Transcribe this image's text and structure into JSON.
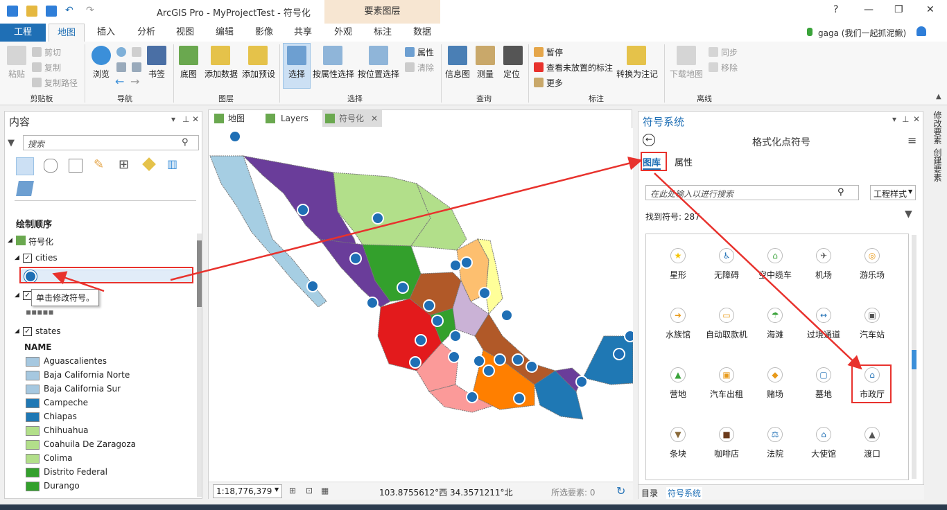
{
  "window": {
    "title": "ArcGIS Pro - MyProjectTest - 符号化",
    "context_tab": "要素图层",
    "help": "?",
    "minimize": "—",
    "restore": "❐",
    "close": "✕"
  },
  "tabs": [
    "工程",
    "地图",
    "插入",
    "分析",
    "视图",
    "编辑",
    "影像",
    "共享",
    "外观",
    "标注",
    "数据"
  ],
  "user": "gaga (我们一起抓泥鳅)",
  "ribbon": {
    "clipboard": {
      "paste": "粘贴",
      "cut": "剪切",
      "copy": "复制",
      "copy_path": "复制路径",
      "group": "剪贴板"
    },
    "nav": {
      "explore": "浏览",
      "bookmark": "书签",
      "group": "导航"
    },
    "layer": {
      "basemap": "底图",
      "add_data": "添加数据",
      "add_preset": "添加预设",
      "group": "图层"
    },
    "select": {
      "select": "选择",
      "by_attr": "按属性选择",
      "by_loc": "按位置选择",
      "attributes": "属性",
      "clear": "清除",
      "group": "选择"
    },
    "inquiry": {
      "info": "信息图",
      "measure": "测量",
      "locate": "定位",
      "group": "查询"
    },
    "label": {
      "pause": "暂停",
      "view_unplaced": "查看未放置的标注",
      "more": "更多",
      "convert": "转换为注记",
      "group": "标注"
    },
    "offline": {
      "download": "下载地图",
      "sync": "同步",
      "remove": "移除",
      "group": "离线"
    }
  },
  "contents": {
    "title": "内容",
    "search_placeholder": "搜索",
    "draw_order": "绘制顺序",
    "map_name": "符号化",
    "layer_cities": "cities",
    "tooltip": "单击修改符号。",
    "layer_states": "states",
    "field_name": "NAME",
    "states": [
      {
        "name": "Aguascalientes",
        "color": "#a6c8e0"
      },
      {
        "name": "Baja California Norte",
        "color": "#a6c8e0"
      },
      {
        "name": "Baja California Sur",
        "color": "#a6c8e0"
      },
      {
        "name": "Campeche",
        "color": "#1f78b4"
      },
      {
        "name": "Chiapas",
        "color": "#1f78b4"
      },
      {
        "name": "Chihuahua",
        "color": "#b2df8a"
      },
      {
        "name": "Coahuila De Zaragoza",
        "color": "#b2df8a"
      },
      {
        "name": "Colima",
        "color": "#b2df8a"
      },
      {
        "name": "Distrito Federal",
        "color": "#33a02c"
      },
      {
        "name": "Durango",
        "color": "#33a02c"
      }
    ]
  },
  "map": {
    "tabs": [
      "地图",
      "Layers",
      "符号化"
    ],
    "scale": "1:18,776,379",
    "coords": "103.8755612°西 34.3571211°北",
    "selected": "所选要素: 0"
  },
  "symbology": {
    "title": "符号系统",
    "header": "格式化点符号",
    "tab_gallery": "图库",
    "tab_props": "属性",
    "search_placeholder": "在此处输入以进行搜索",
    "style_select": "工程样式",
    "found": "找到符号: 287",
    "symbols": [
      {
        "label": "星形",
        "icon": "★",
        "color": "#f5c400"
      },
      {
        "label": "无障碍",
        "icon": "♿",
        "color": "#1f6fb5"
      },
      {
        "label": "空中缆车",
        "icon": "⌂",
        "color": "#3aa33a"
      },
      {
        "label": "机场",
        "icon": "✈",
        "color": "#555555"
      },
      {
        "label": "游乐场",
        "icon": "◎",
        "color": "#e89a1a"
      },
      {
        "label": "水族馆",
        "icon": "➜",
        "color": "#e89a1a"
      },
      {
        "label": "自动取款机",
        "icon": "▭",
        "color": "#e89a1a"
      },
      {
        "label": "海滩",
        "icon": "☂",
        "color": "#3aa33a"
      },
      {
        "label": "过境通道",
        "icon": "↔",
        "color": "#1f6fb5"
      },
      {
        "label": "汽车站",
        "icon": "▣",
        "color": "#555555"
      },
      {
        "label": "营地",
        "icon": "▲",
        "color": "#3aa33a"
      },
      {
        "label": "汽车出租",
        "icon": "▣",
        "color": "#e89a1a"
      },
      {
        "label": "赌场",
        "icon": "◆",
        "color": "#e89a1a"
      },
      {
        "label": "墓地",
        "icon": "▢",
        "color": "#1f6fb5"
      },
      {
        "label": "市政厅",
        "icon": "⌂",
        "color": "#1f6fb5"
      },
      {
        "label": "条块",
        "icon": "▼",
        "color": "#8a6a3a"
      },
      {
        "label": "咖啡店",
        "icon": "■",
        "color": "#6b3a1a"
      },
      {
        "label": "法院",
        "icon": "⚖",
        "color": "#1f6fb5"
      },
      {
        "label": "大使馆",
        "icon": "⌂",
        "color": "#1f6fb5"
      },
      {
        "label": "渡口",
        "icon": "▲",
        "color": "#555555"
      }
    ],
    "bottom_tabs": [
      "目录",
      "符号系统"
    ]
  },
  "rightbar": [
    "修改要素",
    "创建要素"
  ],
  "colors": {
    "accent": "#1f6fb5",
    "annotation": "#e8322d"
  }
}
